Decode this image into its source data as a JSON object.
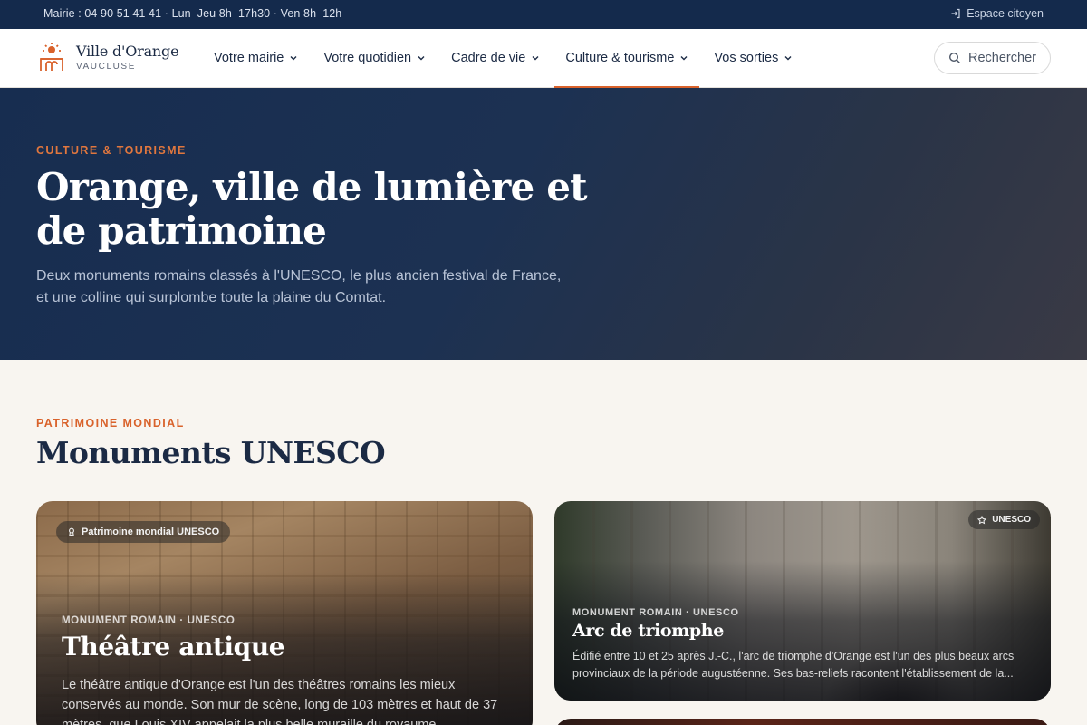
{
  "topbar": {
    "contact": "Mairie : 04 90 51 41 41  ·  Lun–Jeu 8h–17h30  ·  Ven 8h–12h",
    "citizen_label": "Espace citoyen"
  },
  "brand": {
    "name": "Ville d'Orange",
    "region": "VAUCLUSE",
    "accent": "#d9622b",
    "navy": "#142a4c"
  },
  "nav": {
    "items": [
      {
        "label": "Votre mairie"
      },
      {
        "label": "Votre quotidien"
      },
      {
        "label": "Cadre de vie"
      },
      {
        "label": "Culture & tourisme"
      },
      {
        "label": "Vos sorties"
      }
    ],
    "active": "Culture & tourisme",
    "search_label": "Rechercher"
  },
  "hero": {
    "eyebrow": "CULTURE & TOURISME",
    "title": "Orange, ville de lumière et de patrimoine",
    "lead": "Deux monuments romains classés à l'UNESCO, le plus ancien festival de France, et une colline qui surplombe toute la plaine du Comtat."
  },
  "section": {
    "eyebrow": "PATRIMOINE MONDIAL",
    "title": "Monuments UNESCO"
  },
  "cards": [
    {
      "badge": "Patrimoine mondial UNESCO",
      "meta": "MONUMENT ROMAIN · UNESCO",
      "title": "Théâtre antique",
      "description": "Le théâtre antique d'Orange est l'un des théâtres romains les mieux conservés au monde. Son mur de scène, long de 103 mètres et haut de 37 mètres, que Louis XIV appelait la plus belle muraille du royaume..."
    },
    {
      "badge": "UNESCO",
      "meta": "MONUMENT ROMAIN · UNESCO",
      "title": "Arc de triomphe",
      "description": "Édifié entre 10 et 25 après J.-C., l'arc de triomphe d'Orange est l'un des plus beaux arcs provinciaux de la période augustéenne. Ses bas-reliefs racontent l'établissement de la..."
    }
  ]
}
